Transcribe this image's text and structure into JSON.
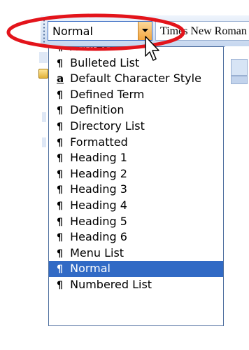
{
  "toolbar": {
    "style_box_value": "Normal",
    "font_box_value": "Times New Roman"
  },
  "style_dropdown": {
    "items": [
      {
        "label": "Address",
        "icon": "paragraph-mark-icon"
      },
      {
        "label": "Bulleted List",
        "icon": "paragraph-mark-icon"
      },
      {
        "label": "Default Character Style",
        "icon": "character-style-icon"
      },
      {
        "label": "Defined Term",
        "icon": "paragraph-mark-icon"
      },
      {
        "label": "Definition",
        "icon": "paragraph-mark-icon"
      },
      {
        "label": "Directory List",
        "icon": "paragraph-mark-icon"
      },
      {
        "label": "Formatted",
        "icon": "paragraph-mark-icon"
      },
      {
        "label": "Heading 1",
        "icon": "paragraph-mark-icon"
      },
      {
        "label": "Heading 2",
        "icon": "paragraph-mark-icon"
      },
      {
        "label": "Heading 3",
        "icon": "paragraph-mark-icon"
      },
      {
        "label": "Heading 4",
        "icon": "paragraph-mark-icon"
      },
      {
        "label": "Heading 5",
        "icon": "paragraph-mark-icon"
      },
      {
        "label": "Heading 6",
        "icon": "paragraph-mark-icon"
      },
      {
        "label": "Menu List",
        "icon": "paragraph-mark-icon"
      },
      {
        "label": "Normal",
        "icon": "paragraph-mark-icon",
        "selected": true
      },
      {
        "label": "Numbered List",
        "icon": "paragraph-mark-icon"
      }
    ]
  },
  "glyphs": {
    "paragraph": "¶",
    "character": "a"
  },
  "colors": {
    "highlight": "#316ac5",
    "annotation": "#e3141b",
    "combo_arrow": "#f3a640"
  }
}
